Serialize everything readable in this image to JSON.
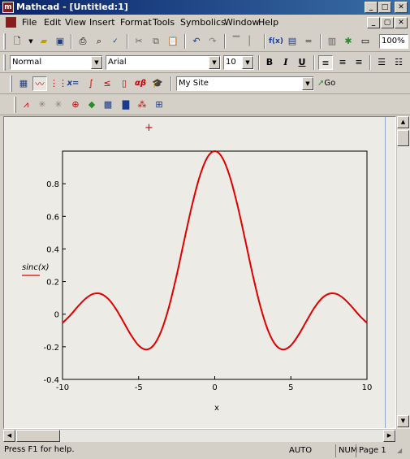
{
  "window": {
    "title": "Mathcad - [Untitled:1]",
    "app_icon_letter": "m",
    "caption_buttons": [
      "_",
      "□",
      "✕"
    ],
    "doc_caption_buttons": [
      "_",
      "▢",
      "✕"
    ]
  },
  "menu": {
    "items": [
      "File",
      "Edit",
      "View",
      "Insert",
      "Format",
      "Tools",
      "Symbolics",
      "Window",
      "Help"
    ]
  },
  "standard_toolbar": {
    "zoom_value": "100%"
  },
  "formatting_toolbar": {
    "style_value": "Normal",
    "font_value": "Arial",
    "size_value": "10",
    "bold_label": "B",
    "italic_label": "I",
    "underline_label": "U"
  },
  "math_toolbar": {
    "xeq_label": "x=",
    "alphabeta_label": "αβ",
    "site_value": "My Site",
    "go_label": "Go"
  },
  "graph_toolbar": {},
  "document": {
    "plot": {
      "y_expression": "sinc(x)",
      "x_expression": "x",
      "line_color": "#e00000"
    }
  },
  "chart_data": {
    "type": "line",
    "title": "",
    "xlabel": "x",
    "ylabel": "sinc(x)",
    "xlim": [
      -10,
      10
    ],
    "ylim": [
      -0.4,
      1.0
    ],
    "x_ticks": [
      "-10",
      "-5",
      "0",
      "5",
      "10"
    ],
    "y_ticks": [
      "-0.4",
      "-0.2",
      "0",
      "0.2",
      "0.4",
      "0.6",
      "0.8"
    ],
    "grid": false,
    "series": [
      {
        "name": "sinc(x)",
        "color": "#e00000",
        "x": [
          -10,
          -9.5,
          -9,
          -8.5,
          -8,
          -7.5,
          -7,
          -6.5,
          -6,
          -5.5,
          -5,
          -4.5,
          -4,
          -3.5,
          -3,
          -2.5,
          -2,
          -1.5,
          -1,
          -0.5,
          0,
          0.5,
          1,
          1.5,
          2,
          2.5,
          3,
          3.5,
          4,
          4.5,
          5,
          5.5,
          6,
          6.5,
          7,
          7.5,
          8,
          8.5,
          9,
          9.5,
          10
        ],
        "y": [
          -0.054,
          -0.008,
          0.046,
          0.094,
          0.124,
          0.125,
          0.094,
          0.033,
          -0.047,
          -0.128,
          -0.192,
          -0.217,
          -0.189,
          -0.1,
          0.047,
          0.239,
          0.455,
          0.665,
          0.841,
          0.959,
          1.0,
          0.959,
          0.841,
          0.665,
          0.455,
          0.239,
          0.047,
          -0.1,
          -0.189,
          -0.217,
          -0.192,
          -0.128,
          -0.047,
          0.033,
          0.094,
          0.125,
          0.124,
          0.094,
          0.046,
          -0.008,
          -0.054
        ]
      }
    ]
  },
  "status": {
    "help_text": "Press F1 for help.",
    "mode": "AUTO",
    "num": "NUM",
    "page": "Page 1"
  },
  "colors": {
    "titlebar": "#0a246a",
    "chrome": "#d4d0c8",
    "worksheet": "#ecebe6",
    "trace": "#e00000"
  }
}
